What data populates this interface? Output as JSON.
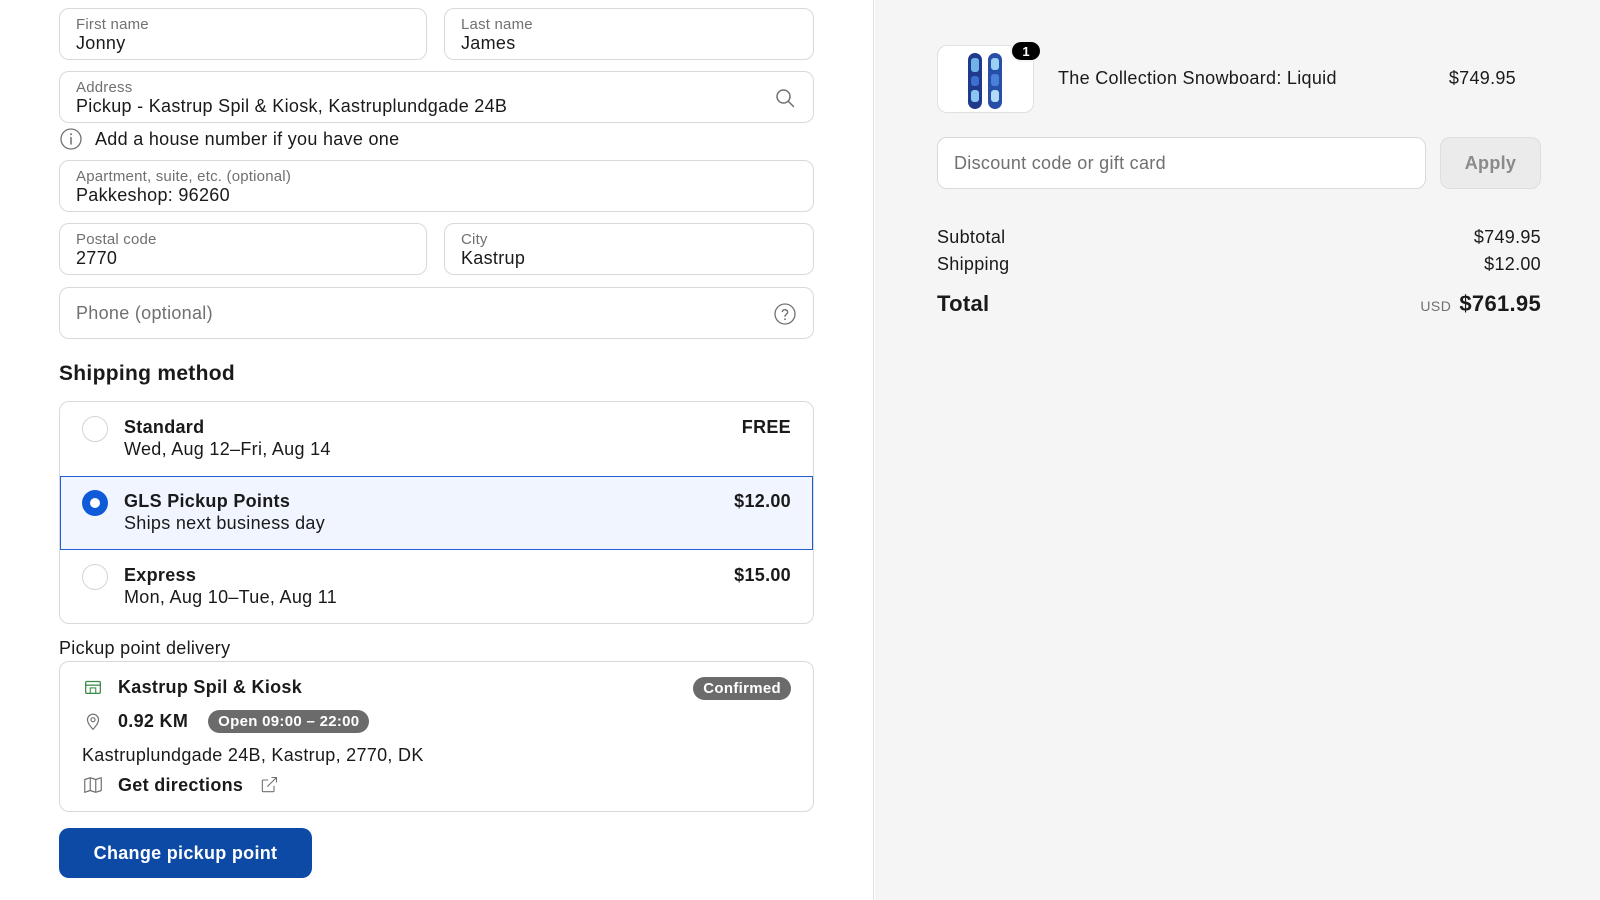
{
  "form": {
    "first_name": {
      "label": "First name",
      "value": "Jonny"
    },
    "last_name": {
      "label": "Last name",
      "value": "James"
    },
    "address": {
      "label": "Address",
      "value": "Pickup - Kastrup Spil & Kiosk, Kastruplundgade 24B"
    },
    "address_hint": "Add a house number if you have one",
    "apartment": {
      "label": "Apartment, suite, etc. (optional)",
      "value": "Pakkeshop: 96260"
    },
    "postal_code": {
      "label": "Postal code",
      "value": "2770"
    },
    "city": {
      "label": "City",
      "value": "Kastrup"
    },
    "phone": {
      "placeholder": "Phone (optional)"
    }
  },
  "shipping": {
    "title": "Shipping method",
    "options": [
      {
        "name": "Standard",
        "sub": "Wed, Aug 12–Fri, Aug 14",
        "price": "FREE",
        "selected": false
      },
      {
        "name": "GLS Pickup Points",
        "sub": "Ships next business day",
        "price": "$12.00",
        "selected": true
      },
      {
        "name": "Express",
        "sub": "Mon, Aug 10–Tue, Aug 11",
        "price": "$15.00",
        "selected": false
      }
    ]
  },
  "pickup": {
    "label": "Pickup point delivery",
    "store_name": "Kastrup Spil & Kiosk",
    "status": "Confirmed",
    "distance": "0.92 KM",
    "hours": "Open 09:00 – 22:00",
    "address": "Kastruplundgade 24B, Kastrup, 2770, DK",
    "directions": "Get directions",
    "change_button": "Change pickup point"
  },
  "cart": {
    "product_name": "The Collection Snowboard: Liquid",
    "product_price": "$749.95",
    "quantity": "1",
    "discount_placeholder": "Discount code or gift card",
    "apply_label": "Apply",
    "subtotal_label": "Subtotal",
    "subtotal_value": "$749.95",
    "shipping_label": "Shipping",
    "shipping_value": "$12.00",
    "total_label": "Total",
    "total_currency": "USD",
    "total_value": "$761.95"
  },
  "colors": {
    "accent": "#0f5ad8",
    "button": "#0c4aa6",
    "selected_bg": "#f0f5ff",
    "summary_bg": "#f5f5f5"
  }
}
